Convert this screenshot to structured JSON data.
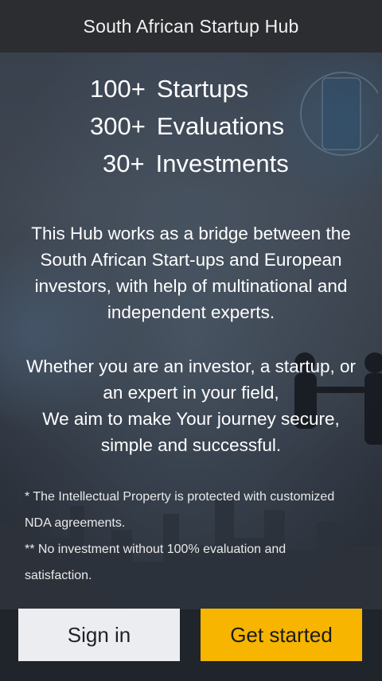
{
  "header": {
    "title": "South African Startup Hub"
  },
  "stats": [
    {
      "number": "100+",
      "label": "Startups"
    },
    {
      "number": "300+",
      "label": "Evaluations"
    },
    {
      "number": "30+",
      "label": "Investments"
    }
  ],
  "intro": {
    "lines": [
      "This Hub works as a bridge between the",
      "South African Start-ups and European",
      "investors, with help of multinational and",
      "independent experts."
    ]
  },
  "mission": {
    "lines": [
      "Whether you are an investor, a startup, or",
      "an expert in your field,",
      "We aim to make Your journey secure,",
      "simple and successful."
    ]
  },
  "notes": {
    "lines": [
      "* The Intellectual Property is protected with customized",
      "NDA agreements.",
      "** No investment without 100% evaluation and",
      "satisfaction."
    ]
  },
  "buttons": {
    "sign_in": "Sign in",
    "get_started": "Get started"
  },
  "colors": {
    "topbar": "#2c2d30",
    "primary_button": "#f7b500",
    "secondary_button": "#ecedf0"
  }
}
